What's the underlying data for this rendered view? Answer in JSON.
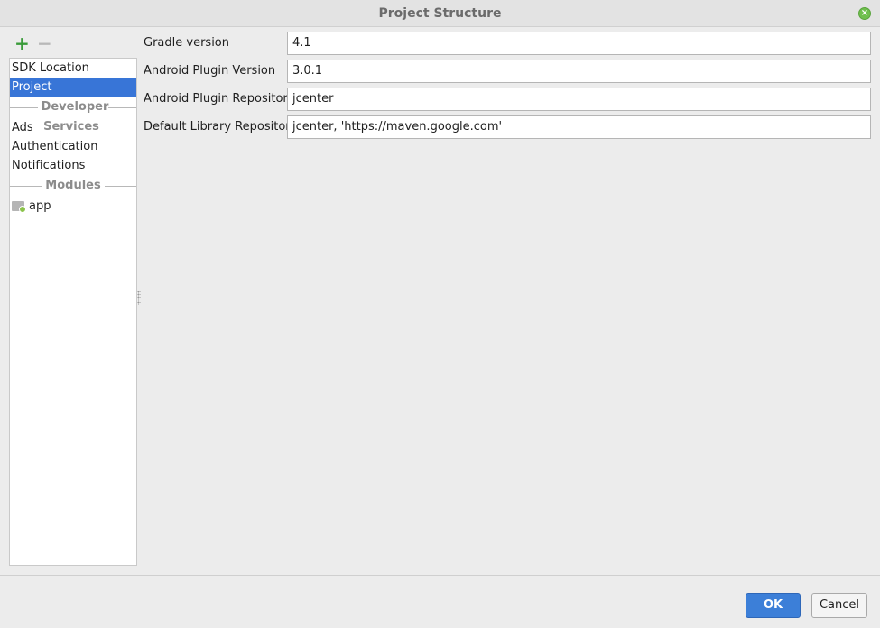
{
  "window": {
    "title": "Project Structure",
    "close_icon": "close-icon",
    "accent_color": "#3875d7"
  },
  "toolbar": {
    "add_label": "+",
    "remove_label": "−"
  },
  "sidebar": {
    "items": [
      {
        "label": "SDK Location"
      },
      {
        "label": "Project",
        "selected": true
      }
    ],
    "developer_services": {
      "header": "Developer Services",
      "items": [
        {
          "label": "Ads"
        },
        {
          "label": "Authentication"
        },
        {
          "label": "Notifications"
        }
      ]
    },
    "modules": {
      "header": "Modules",
      "items": [
        {
          "label": "app",
          "icon": "module-folder-icon"
        }
      ]
    }
  },
  "form": {
    "fields": [
      {
        "label": "Gradle version",
        "value": "4.1"
      },
      {
        "label": "Android Plugin Version",
        "value": "3.0.1"
      },
      {
        "label": "Android Plugin Repository",
        "value": "jcenter"
      },
      {
        "label": "Default Library Repository",
        "value": "jcenter, 'https://maven.google.com'"
      }
    ]
  },
  "footer": {
    "ok_label": "OK",
    "cancel_label": "Cancel"
  }
}
